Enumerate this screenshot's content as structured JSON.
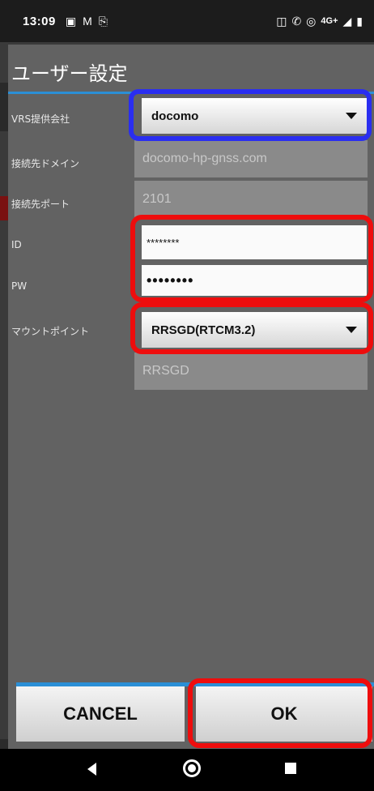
{
  "status_bar": {
    "time": "13:09",
    "network": "4G+"
  },
  "dialog": {
    "title": "ユーザー設定",
    "fields": {
      "vrs_label": "VRS提供会社",
      "vrs_value": "docomo",
      "domain_label": "接続先ドメイン",
      "domain_value": "docomo-hp-gnss.com",
      "port_label": "接続先ポート",
      "port_value": "2101",
      "id_label": "ID",
      "id_value": "********",
      "pw_label": "PW",
      "pw_value": "••••••••",
      "mount_label": "マウントポイント",
      "mount_value": "RRSGD(RTCM3.2)",
      "mount_sub_value": "RRSGD"
    },
    "buttons": {
      "cancel": "CANCEL",
      "ok": "OK"
    }
  },
  "highlight_colors": {
    "blue": "#2a2ef0",
    "red": "#ee0d0d"
  }
}
